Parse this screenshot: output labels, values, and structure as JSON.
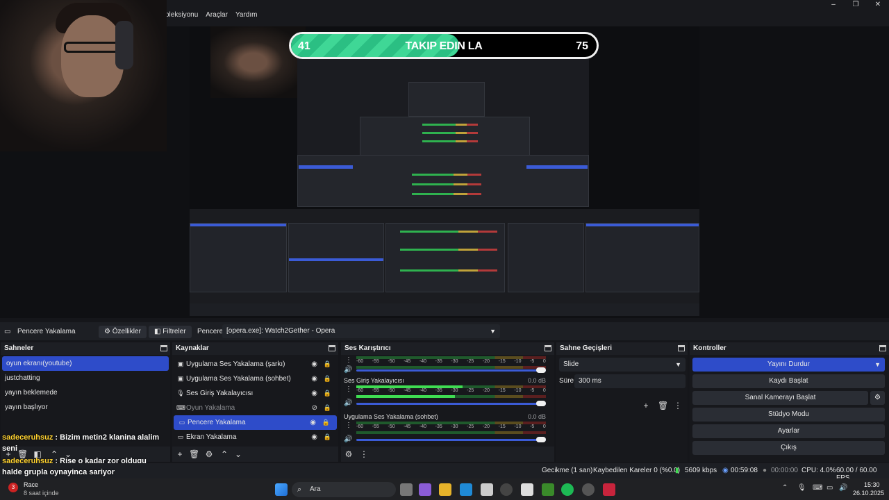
{
  "menu": {
    "items": [
      "oleksiyonu",
      "Araçlar",
      "Yardım"
    ]
  },
  "window_controls": {
    "minimize": "–",
    "maximize": "❐",
    "close": "✕"
  },
  "overlay": {
    "follow_left": "41",
    "follow_title": "TAKIP EDIN LA",
    "follow_right": "75",
    "follow_progress": 0.55
  },
  "toolbar": {
    "source_name": "Pencere Yakalama",
    "properties_label": "Özellikler",
    "filters_label": "Filtreler",
    "window_label": "Pencere",
    "window_value": "[opera.exe]: Watch2Gether - Opera"
  },
  "scenes": {
    "title": "Sahneler",
    "items": [
      "oyun ekranı(youtube)",
      "justchatting",
      "yayın beklemede",
      "yayın başlıyor"
    ]
  },
  "sources": {
    "title": "Kaynaklar",
    "items": [
      {
        "label": "Uygulama Ses Yakalama (şarkı)",
        "icon": "app-audio-icon"
      },
      {
        "label": "Uygulama Ses Yakalama (sohbet)",
        "icon": "app-audio-icon"
      },
      {
        "label": "Ses Giriş Yakalayıcısı",
        "icon": "microphone-icon"
      },
      {
        "label": "Oyun Yakalama",
        "icon": "gamepad-icon"
      },
      {
        "label": "Pencere Yakalama",
        "icon": "window-icon"
      },
      {
        "label": "Ekran Yakalama",
        "icon": "monitor-icon"
      }
    ]
  },
  "mixer": {
    "title": "Ses Karıştırıcı",
    "scale": [
      "-60",
      "-55",
      "-50",
      "-45",
      "-40",
      "-35",
      "-30",
      "-25",
      "-20",
      "-15",
      "-10",
      "-5",
      "0"
    ],
    "tracks": [
      {
        "name": "",
        "db": ""
      },
      {
        "name": "Ses Giriş Yakalayıcısı",
        "db": "0.0 dB"
      },
      {
        "name": "Uygulama Ses Yakalama (sohbet)",
        "db": "0.0 dB"
      }
    ]
  },
  "transitions": {
    "title": "Sahne Geçişleri",
    "type": "Slide",
    "duration_label": "Süre",
    "duration_value": "300 ms"
  },
  "controls": {
    "title": "Kontroller",
    "stop_stream": "Yayını Durdur",
    "start_record": "Kaydı Başlat",
    "virtual_cam": "Sanal Kamerayı Başlat",
    "studio_mode": "Stüdyo Modu",
    "settings": "Ayarlar",
    "exit": "Çıkış"
  },
  "chat": [
    {
      "user": "sadeceruhsuz",
      "text": " : Bizim metin2 klanina alalim"
    },
    {
      "user": "",
      "text": "seni"
    },
    {
      "user": "sadeceruhsuz",
      "text": " : Rise o kadar zor oldugu"
    },
    {
      "user": "",
      "text": "halde grupla oynayinca sariyor"
    }
  ],
  "status": {
    "delay": "Gecikme (1 san)",
    "dropped": "Kaybedilen Kareler 0 (%0.0)",
    "bitrate": "5609 kbps",
    "stream_time": "00:59:08",
    "rec_time": "00:00:00",
    "cpu": "CPU: 4.0%",
    "fps": "60.00 / 60.00 FPS"
  },
  "taskbar": {
    "notif_title": "Race",
    "notif_sub": "8 saat içinde",
    "notif_badge": "3",
    "search": "Ara",
    "time": "15:30",
    "date": "26.10.2025"
  }
}
